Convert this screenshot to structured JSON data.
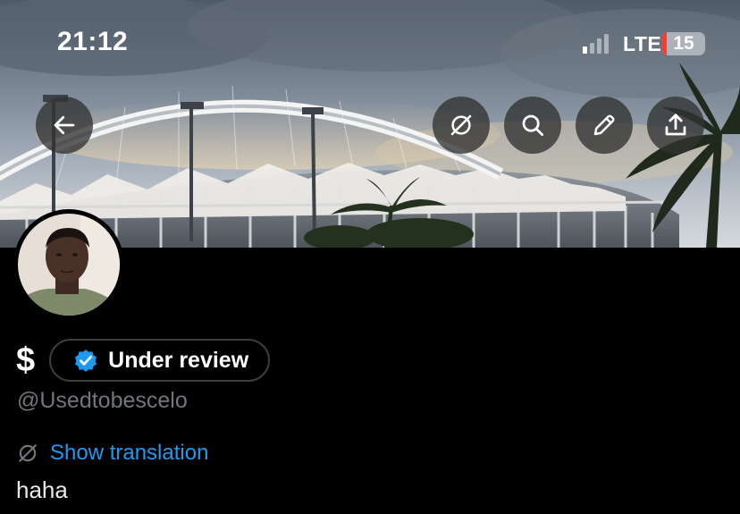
{
  "status_bar": {
    "time": "21:12",
    "network": "LTE",
    "battery": "15",
    "signal_bars_active": 1,
    "signal_bars_total": 4
  },
  "header_actions": {
    "back": "arrow-left-icon",
    "translate": "translate-off-icon",
    "search": "search-icon",
    "edit": "pencil-icon",
    "share": "share-icon"
  },
  "profile": {
    "display_name": "$",
    "verification_label": "Under review",
    "handle": "@Usedtobescelo",
    "show_translation": "Show translation",
    "bio": "haha"
  },
  "colors": {
    "background": "#000000",
    "link": "#1d9bf0",
    "muted_text": "#71767b",
    "verified_badge": "#1d9bf0",
    "battery_low": "#ff3b30"
  }
}
